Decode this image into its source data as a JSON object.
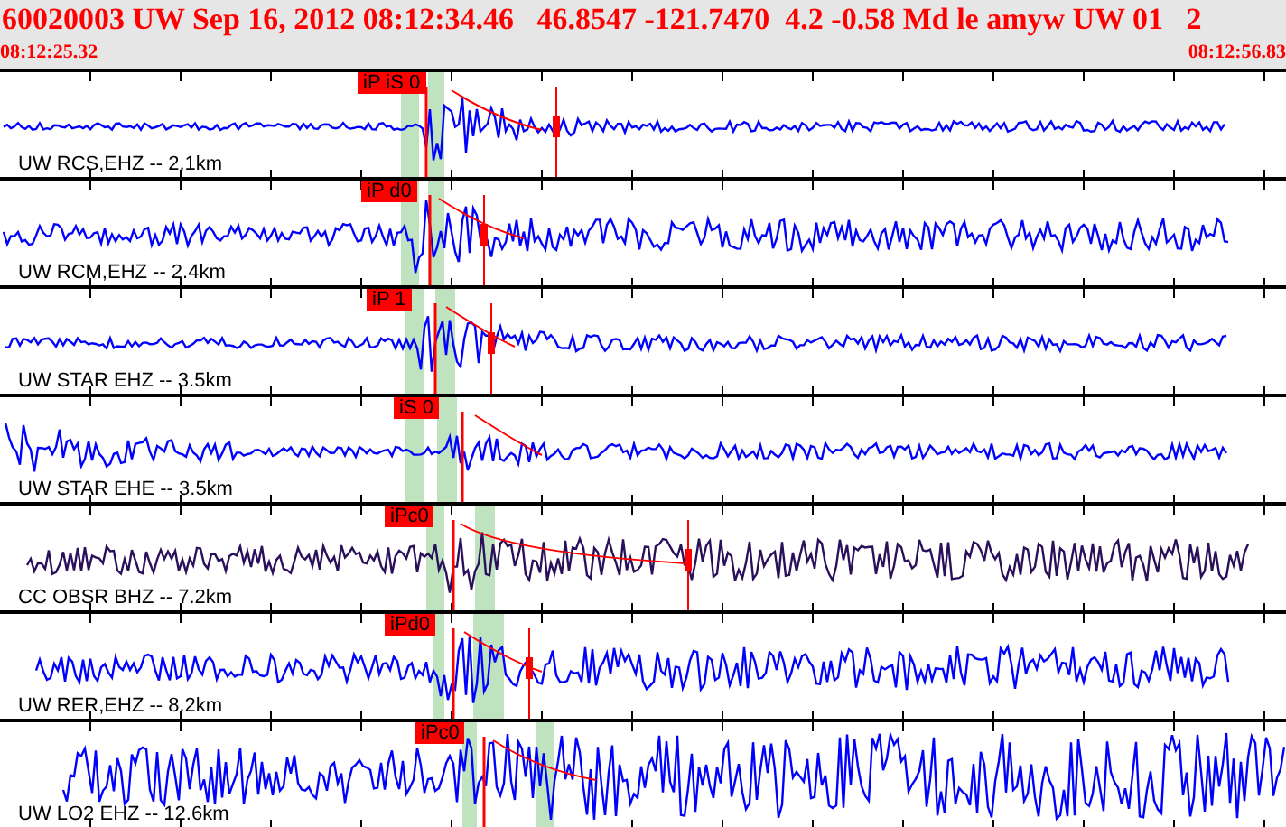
{
  "header": {
    "title": "60020003 UW Sep 16, 2012 08:12:34.46   46.8547 -121.7470  4.2 -0.58 Md le amyw UW 01   2",
    "start_time": "08:12:25.32",
    "end_time": "08:12:56.83"
  },
  "traces": [
    {
      "label": "UW RCS,EHZ -- 2.1km",
      "pick": "iP iS 0",
      "color": "#0000ff"
    },
    {
      "label": "UW RCM,EHZ -- 2.4km",
      "pick": "iP d0",
      "color": "#0000ff"
    },
    {
      "label": "UW STAR EHZ -- 3.5km",
      "pick": "iP 1",
      "color": "#0000ff"
    },
    {
      "label": "UW STAR EHE -- 3.5km",
      "pick": "iS 0",
      "color": "#0000ff"
    },
    {
      "label": "CC OBSR BHZ -- 7.2km",
      "pick": "iPc0",
      "color": "#2a0f5a"
    },
    {
      "label": "UW RER,EHZ -- 8.2km",
      "pick": "iPd0",
      "color": "#0000ff"
    },
    {
      "label": "UW LO2 EHZ -- 12.6km",
      "pick": "iPc0",
      "color": "#0000ff"
    }
  ]
}
